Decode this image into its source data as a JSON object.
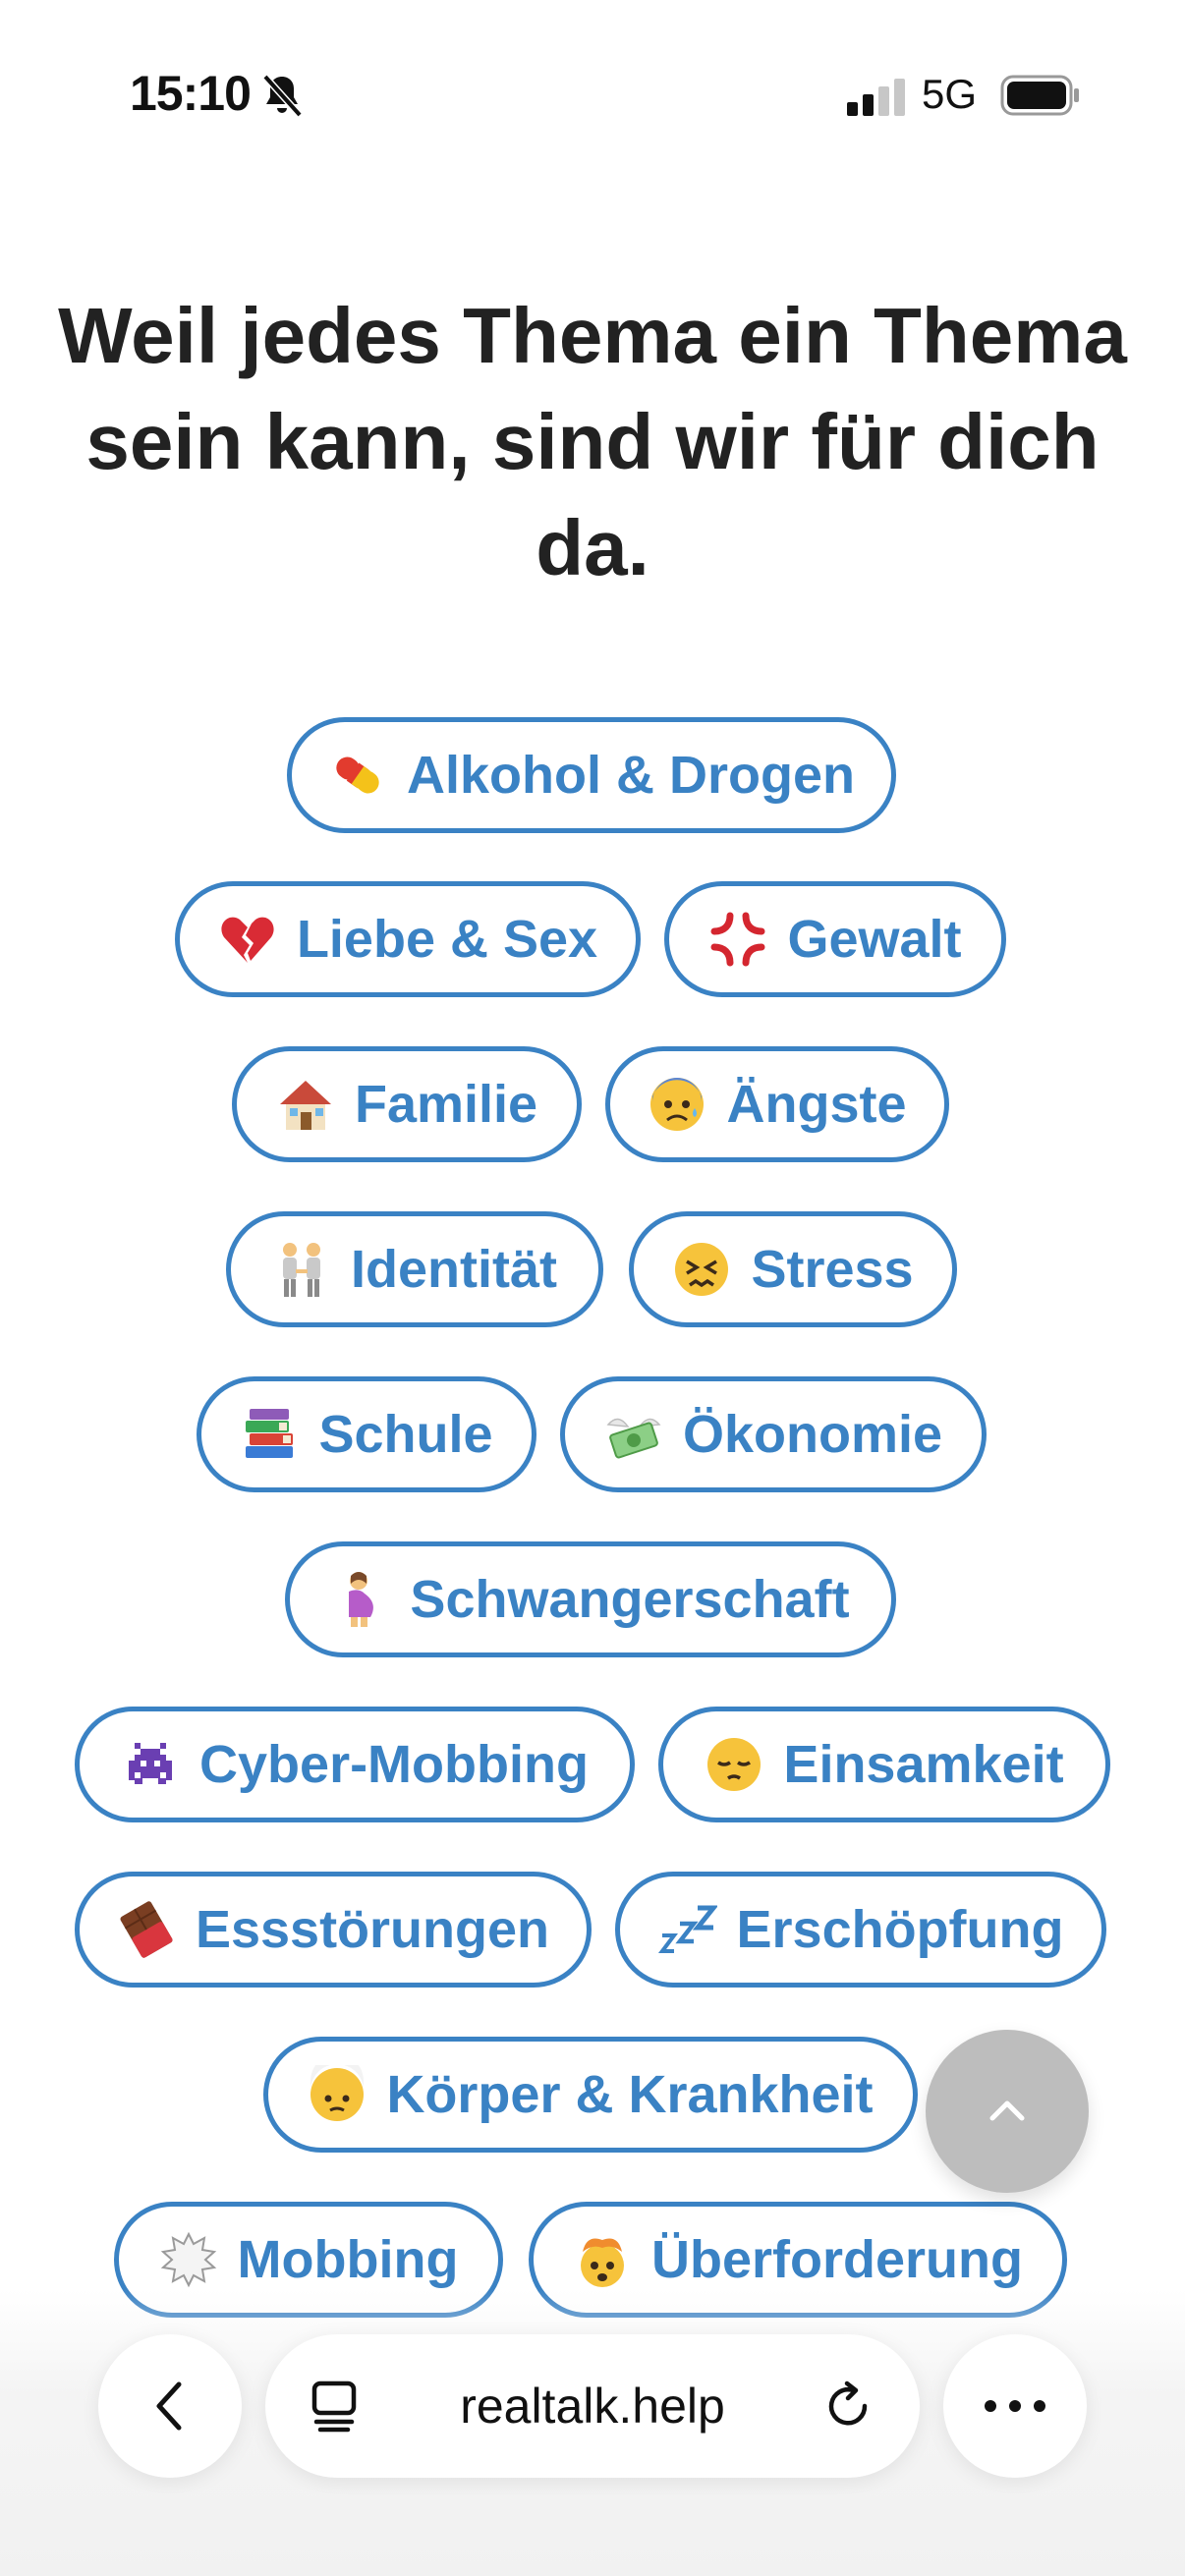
{
  "status_bar": {
    "time": "15:10",
    "network": "5G",
    "silent_icon": "bell-slash-icon",
    "signal_icon": "cellular-signal-icon",
    "battery_icon": "battery-icon"
  },
  "headline": "Weil jedes Thema ein Thema sein kann, sind wir für dich da.",
  "topics": [
    {
      "label": "Alkohol & Drogen",
      "icon": "pill-icon"
    },
    {
      "label": "Liebe & Sex",
      "icon": "broken-heart-icon"
    },
    {
      "label": "Gewalt",
      "icon": "anger-symbol-icon"
    },
    {
      "label": "Familie",
      "icon": "house-icon"
    },
    {
      "label": "Ängste",
      "icon": "anxious-face-icon"
    },
    {
      "label": "Identität",
      "icon": "people-holding-hands-icon"
    },
    {
      "label": "Stress",
      "icon": "confounded-face-icon"
    },
    {
      "label": "Schule",
      "icon": "books-icon"
    },
    {
      "label": "Ökonomie",
      "icon": "money-with-wings-icon"
    },
    {
      "label": "Schwangerschaft",
      "icon": "pregnant-woman-icon"
    },
    {
      "label": "Cyber-Mobbing",
      "icon": "space-invader-icon"
    },
    {
      "label": "Einsamkeit",
      "icon": "pensive-face-icon"
    },
    {
      "label": "Essstörungen",
      "icon": "chocolate-bar-icon"
    },
    {
      "label": "Erschöpfung",
      "icon": "zzz-icon"
    },
    {
      "label": "Körper & Krankheit",
      "icon": "bandaged-head-face-icon"
    },
    {
      "label": "Mobbing",
      "icon": "anger-bubble-icon"
    },
    {
      "label": "Überforderung",
      "icon": "exploding-head-icon"
    }
  ],
  "colors": {
    "accent": "#3a82c4",
    "headline": "#222222",
    "scroll_top_button": "#bdbdbd"
  },
  "scroll_top": {
    "icon": "chevron-up-icon"
  },
  "browser": {
    "url": "realtalk.help",
    "back_icon": "chevron-left-icon",
    "tabs_icon": "tab-overview-icon",
    "reload_icon": "reload-icon",
    "menu_icon": "more-dots-icon"
  }
}
